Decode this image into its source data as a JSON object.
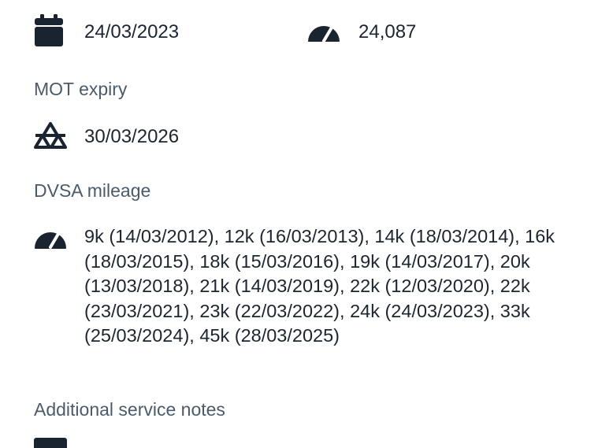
{
  "service_date": {
    "icon": "calendar-icon",
    "value": "24/03/2023"
  },
  "service_mileage": {
    "icon": "speedometer-icon",
    "value": "24,087"
  },
  "mot_expiry": {
    "label": "MOT expiry",
    "icon": "mot-triangles-icon",
    "value": "30/03/2026"
  },
  "dvsa_mileage": {
    "label": "DVSA mileage",
    "icon": "speedometer-icon",
    "value": "9k (14/03/2012), 12k (16/03/2013), 14k (18/03/2014), 16k (18/03/2015), 18k (15/03/2016), 19k (14/03/2017), 20k (13/03/2018), 21k (14/03/2019), 22k (12/03/2020), 22k (23/03/2021), 23k (22/03/2022), 24k (24/03/2023), 33k (25/03/2024), 45k (28/03/2025)"
  },
  "additional_notes": {
    "label": "Additional service notes",
    "icon": "notes-icon"
  },
  "colors": {
    "icon": "#1a2430",
    "label": "#4b5b6b",
    "text": "#1c2530",
    "background": "#ffffff"
  }
}
